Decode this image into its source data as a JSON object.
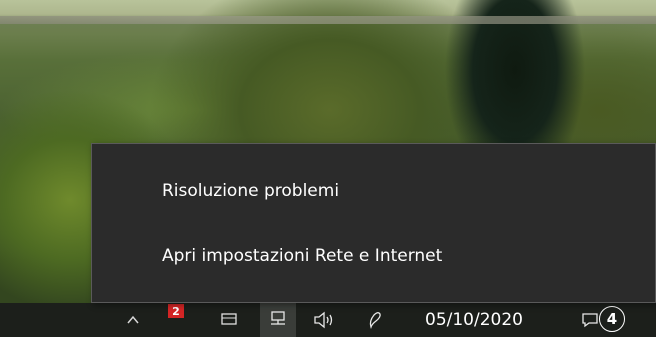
{
  "context_menu": {
    "items": [
      {
        "label": "Risoluzione problemi"
      },
      {
        "label": "Apri impostazioni Rete e Internet"
      }
    ]
  },
  "taskbar": {
    "clock_date": "05/10/2020",
    "notification_count": "4",
    "tray_badge_count": "2",
    "colors": {
      "taskbar_bg": "#1c1f1b",
      "menu_bg": "#2b2b2b",
      "badge_red": "#d32525"
    },
    "icons": [
      "chevron-up-icon",
      "app-badge-icon",
      "battery-icon",
      "network-icon",
      "volume-icon",
      "pen-icon",
      "notification-icon"
    ]
  }
}
